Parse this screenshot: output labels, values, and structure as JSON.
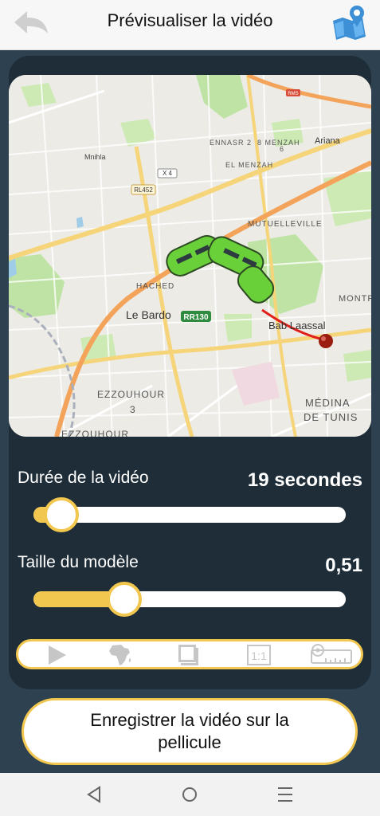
{
  "header": {
    "title": "Prévisualiser la vidéo",
    "back_icon": "back-arrow-icon",
    "map_icon": "map-pin-icon"
  },
  "map": {
    "labels": {
      "ariana": "Ariana",
      "ennasr": "ENNASR 2",
      "menzah8": "8 MENZAH",
      "elmenzah": "EL MENZAH",
      "menzah6": "6",
      "mnihla": "Mnihla",
      "x4": "X 4",
      "rl452": "RL452",
      "mutuelleville": "MUTUELLEVILLE",
      "hached": "HACHED",
      "lebardo": "Le Bardo",
      "rr130": "RR130",
      "bablaassal": "Bab Laassal",
      "montr": "MONTR",
      "ezzouhour": "EZZOUHOUR",
      "ezz3": "3",
      "ezzouhour2": "EZZOUHOUR",
      "medina1": "MÉDINA",
      "medina2": "DE TUNIS",
      "rms": "RMS"
    }
  },
  "duration": {
    "label": "Durée de la vidéo",
    "value": "19 secondes",
    "level": 0.09
  },
  "model_size": {
    "label": "Taille du modèle",
    "value": "0,51",
    "level": 0.29
  },
  "toolbar": {
    "icons": [
      "play-icon",
      "africa-map-icon",
      "square-frame-icon",
      "aspect-ratio-icon",
      "tape-measure-icon"
    ],
    "ratio_label": "1:1"
  },
  "save_button": {
    "line1": "Enregistrer la vidéo sur la",
    "line2": "pellicule"
  },
  "navbar": {
    "icons": [
      "nav-back-icon",
      "nav-home-icon",
      "nav-recent-icon"
    ]
  },
  "colors": {
    "accent": "#f2c74f",
    "panel": "#1e2d38",
    "background": "#2d4150",
    "route": "#e0201b",
    "tram": "#6ad039"
  }
}
